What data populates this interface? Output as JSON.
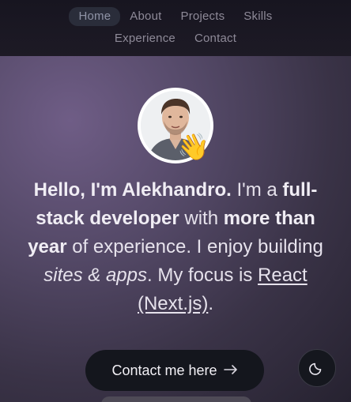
{
  "nav": {
    "row1": [
      "Home",
      "About",
      "Projects",
      "Skills"
    ],
    "row2": [
      "Experience",
      "Contact"
    ],
    "active": "Home"
  },
  "hero": {
    "wave_emoji": "👋",
    "intro": {
      "p1_bold": "Hello, I'm Alekhandro.",
      "p2": " I'm a ",
      "p3_bold": "full-stack developer",
      "p4": " with ",
      "p5_bold": "more than year",
      "p6": " of experience. I enjoy building ",
      "p7_italic": "sites & apps",
      "p8": ". My focus is ",
      "p9_underline": "React (Next.js)",
      "p10": "."
    },
    "cta_label": "Contact me here",
    "cta_icon": "arrow-right-icon",
    "theme_icon": "moon-icon"
  },
  "colors": {
    "header_bg": "#1a1822",
    "page_gradient_light": "#6f5d86",
    "page_gradient_dark": "#262230",
    "button_bg": "#14161d"
  }
}
